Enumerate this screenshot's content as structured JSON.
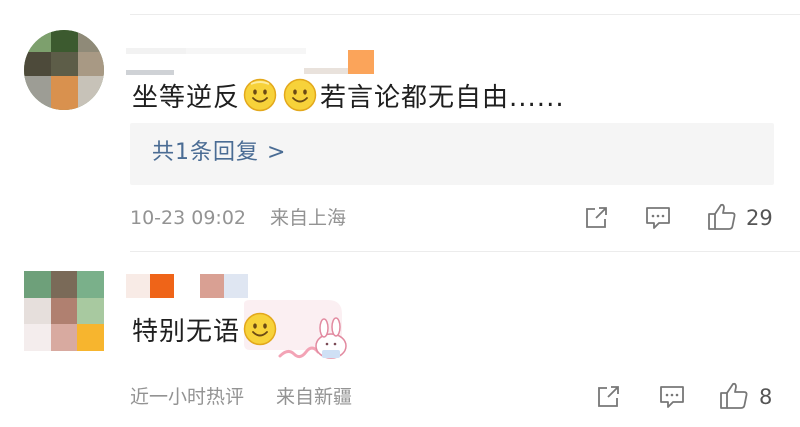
{
  "comments": [
    {
      "text": "坐等逆反",
      "text_after_emoji": "若言论都无自由......",
      "reply_summary": "共1条回复 >",
      "timestamp": "10-23 09:02",
      "location": "来自上海",
      "likes": "29",
      "emoji": [
        "smile-emoji",
        "smile-emoji"
      ]
    },
    {
      "text": "特别无语",
      "timestamp": "近一小时热评",
      "location": "来自新疆",
      "likes": "8",
      "emoji": [
        "smile-emoji"
      ],
      "sticker": "bunny-sticker"
    }
  ],
  "icons": {
    "share": "share-icon",
    "comment": "comment-icon",
    "like": "thumbs-up-icon"
  },
  "colors": {
    "reply_link": "#4a6c94",
    "meta_text": "#939393",
    "reply_bg": "#f5f5f5",
    "emoji_face": "#f7d23a"
  }
}
